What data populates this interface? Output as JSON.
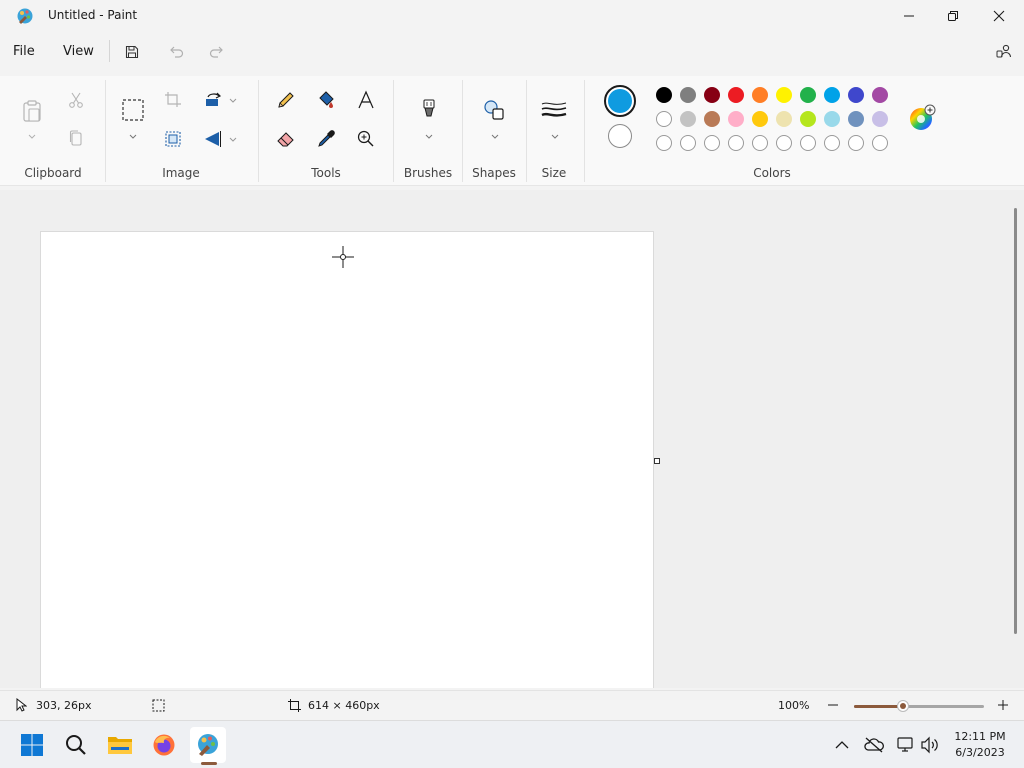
{
  "window": {
    "title": "Untitled - Paint"
  },
  "menu": {
    "file": "File",
    "view": "View"
  },
  "ribbon": {
    "groups": {
      "clipboard": "Clipboard",
      "image": "Image",
      "tools": "Tools",
      "brushes": "Brushes",
      "shapes": "Shapes",
      "size": "Size",
      "colors": "Colors"
    },
    "colors": {
      "primary": "#0f9be0",
      "secondary": "#ffffff",
      "palette_row1": [
        "#000000",
        "#7f7f7f",
        "#870014",
        "#ec1c23",
        "#ff7e26",
        "#fff200",
        "#22b14b",
        "#00a2e8",
        "#3f47cc",
        "#a349a4"
      ],
      "palette_row2": [
        "#ffffff",
        "#c3c3c3",
        "#b97a56",
        "#ffaec8",
        "#ffc90d",
        "#eee3af",
        "#b5e61d",
        "#99d9ea",
        "#7092be",
        "#c8bfe7"
      ],
      "custom_slots": 10
    }
  },
  "status": {
    "cursor_position": "303, 26px",
    "canvas_size": "614 × 460px",
    "zoom": "100%",
    "zoom_fraction": 0.38
  },
  "taskbar": {
    "time": "12:11 PM",
    "date": "6/3/2023",
    "apps": [
      "start-icon",
      "search-icon",
      "file-explorer-icon",
      "firefox-icon",
      "paint-icon"
    ]
  }
}
